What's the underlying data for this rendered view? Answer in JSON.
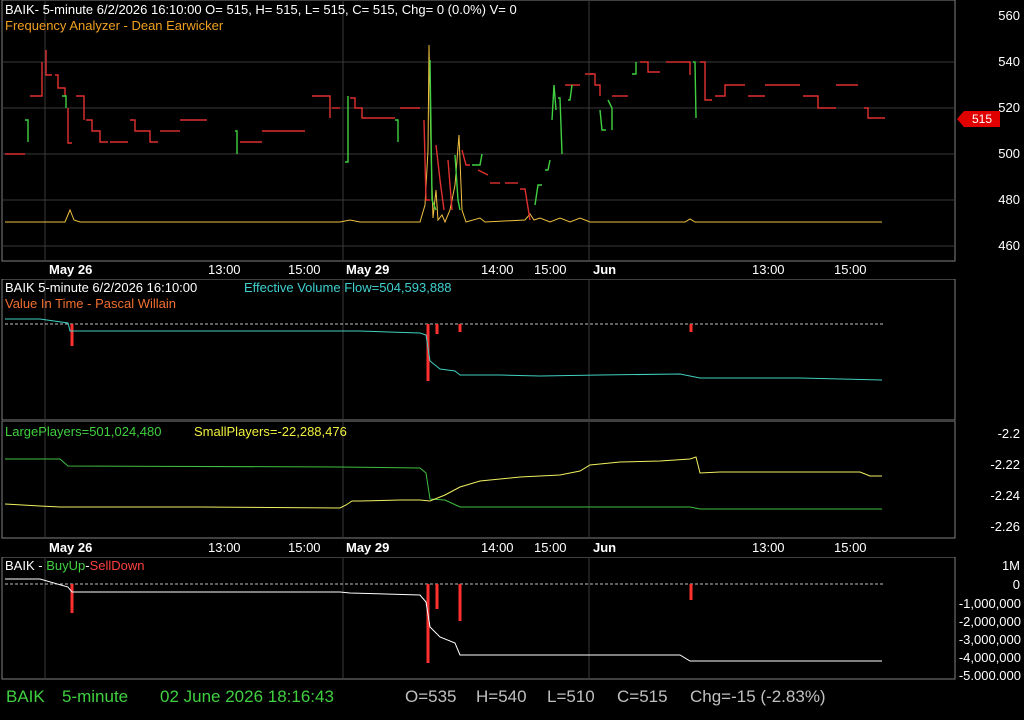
{
  "panel1": {
    "header": "BAIK- 5-minute 6/2/2026 16:10:00 O= 515, H= 515, L= 515, C= 515, Chg= 0 (0.0%) V= 0",
    "indicator": "Frequency Analyzer - Dean Earwicker",
    "y_ticks": [
      "560",
      "540",
      "520",
      "500",
      "480",
      "460"
    ],
    "last_price": "515",
    "colors": {
      "up": "#40d040",
      "down": "#e03030",
      "freq": "#f0c040"
    }
  },
  "xaxis": {
    "labels": [
      "May 26",
      "13:00",
      "15:00",
      "May 29",
      "14:00",
      "15:00",
      "Jun",
      "13:00",
      "15:00"
    ]
  },
  "panel2": {
    "header": "BAIK 5-minute  6/2/2026 16:10:00",
    "flow": "Effective Volume Flow=504,593,888",
    "indicator": "Value In Time - Pascal Willain"
  },
  "panel3": {
    "large": "LargePlayers=501,024,480",
    "small": "SmallPlayers=-22,288,476",
    "y_ticks": [
      "-2.2",
      "-2.22",
      "-2.24",
      "-2.26"
    ]
  },
  "panel4": {
    "prefix": "BAIK - ",
    "buy": "BuyUp",
    "sep": "-",
    "sell": "SellDown",
    "y_ticks": [
      "1M",
      "0",
      "-1,000,000",
      "-2,000,000",
      "-3,000,000",
      "-4,000,000",
      "-5,000,000"
    ]
  },
  "status": {
    "symbol": "BAIK",
    "interval": "5-minute",
    "datetime": "02 June 2026 18:16:43",
    "open": "O=535",
    "high": "H=540",
    "low": "L=510",
    "close": "C=515",
    "change": "Chg=-15 (-2.83%)"
  }
}
